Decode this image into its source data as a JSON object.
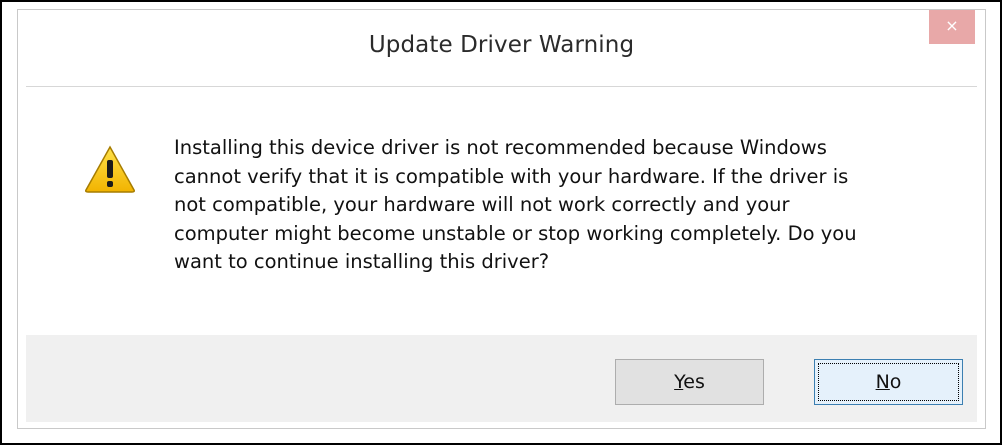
{
  "dialog": {
    "title": "Update Driver Warning",
    "close_label": "×",
    "message": "Installing this device driver is not recommended because Windows\ncannot verify that it is compatible with your hardware.  If the driver is\nnot compatible, your hardware will not work correctly and your\ncomputer might become unstable or stop working completely.  Do you\nwant to continue installing this driver?",
    "icon": "warning-icon",
    "buttons": {
      "yes": {
        "mnemonic": "Y",
        "rest": "es"
      },
      "no": {
        "mnemonic": "N",
        "rest": "o"
      }
    }
  },
  "colors": {
    "close_bg": "#e8a8a8",
    "footer_bg": "#f0f0f0",
    "warning_yellow": "#f5c400",
    "default_button_border": "#3c7fb1"
  }
}
